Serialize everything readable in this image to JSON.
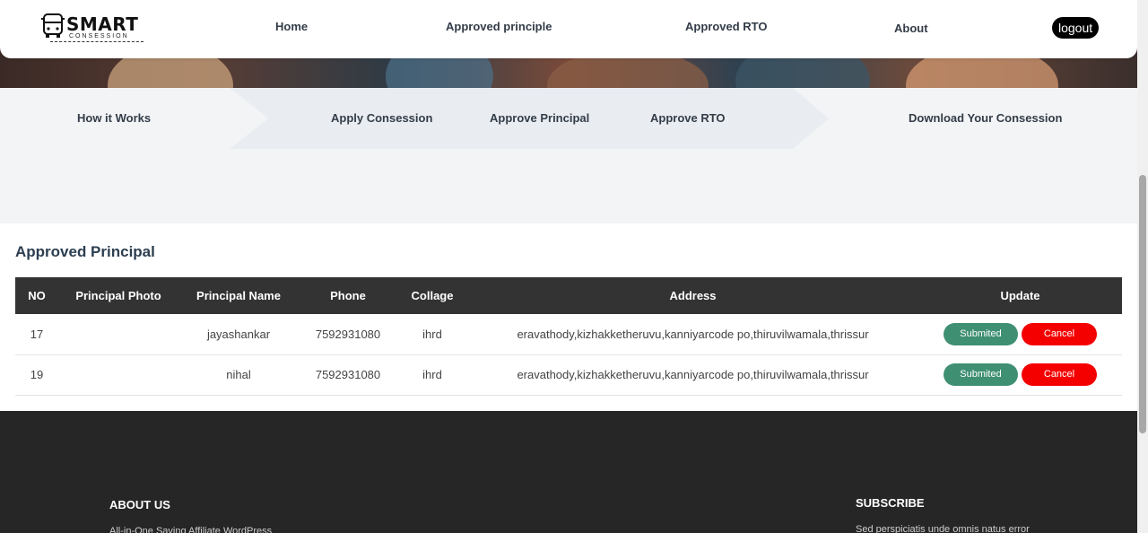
{
  "logo": {
    "title": "SMART",
    "subtitle": "CONSESSION"
  },
  "nav": {
    "home": "Home",
    "approved_principle": "Approved principle",
    "approved_rto": "Approved RTO",
    "about": "About",
    "logout": "logout"
  },
  "steps": {
    "how": "How it Works",
    "apply": "Apply Consession",
    "approve_principal": "Approve Principal",
    "approve_rto": "Approve RTO",
    "download": "Download Your Consession"
  },
  "section_title": "Approved Principal",
  "table": {
    "headers": [
      "NO",
      "Principal Photo",
      "Principal Name",
      "Phone",
      "Collage",
      "Address",
      "Update"
    ],
    "rows": [
      {
        "no": "17",
        "photo": "",
        "name": "jayashankar",
        "phone": "7592931080",
        "collage": "ihrd",
        "address": "eravathody,kizhakketheruvu,kanniyarcode po,thiruvilwamala,thrissur",
        "submit": "Submited",
        "cancel": "Cancel"
      },
      {
        "no": "19",
        "photo": "",
        "name": "nihal",
        "phone": "7592931080",
        "collage": "ihrd",
        "address": "eravathody,kizhakketheruvu,kanniyarcode po,thiruvilwamala,thrissur",
        "submit": "Submited",
        "cancel": "Cancel"
      }
    ]
  },
  "footer": {
    "about_heading": "ABOUT US",
    "about_text": "All-in-One Saving Affiliate WordPress",
    "subscribe_heading": "SUBSCRIBE",
    "subscribe_text": "Sed perspiciatis unde omnis natus error"
  },
  "colors": {
    "submit": "#3f8f73",
    "cancel": "#f40000",
    "table_header": "#333333",
    "footer": "#262626"
  }
}
